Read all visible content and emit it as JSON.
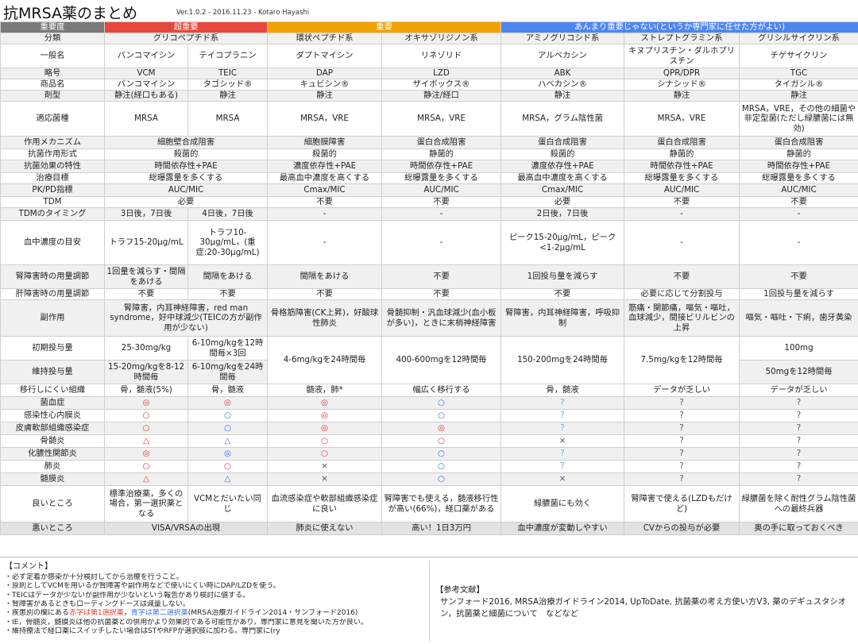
{
  "header": {
    "title": "抗MRSA薬のまとめ",
    "subtitle": "Ver.1.0.2 - 2016.11.23 - Kotaro Hayashi"
  },
  "importance": {
    "label": "重要度",
    "c1": "超重要",
    "c2": "重要",
    "c3": "あんまり重要じゃない(というか専門家に任せた方がよい)"
  },
  "rows": {
    "bunrui": {
      "label": "分類",
      "c1": "グリコペプチド系",
      "c2a": "環状ペプチド系",
      "c2b": "オキサゾリジノン系",
      "c3a": "アミノグリコシド系",
      "c3b": "ストレプトグラミン系",
      "c3c": "グリシルサイクリン系"
    },
    "ippanmei": {
      "label": "一般名",
      "d": [
        "バンコマイシン",
        "テイコプラニン",
        "ダプトマイシン",
        "リネゾリド",
        "アルベカシン",
        "キヌプリスチン・ダルホプリスチン",
        "チゲサイクリン"
      ]
    },
    "ryakugo": {
      "label": "略号",
      "d": [
        "VCM",
        "TEIC",
        "DAP",
        "LZD",
        "ABK",
        "QPR/DPR",
        "TGC"
      ]
    },
    "shohinmei": {
      "label": "商品名",
      "d": [
        "バンコマイシン",
        "タゴシッド®",
        "キュビシン®",
        "ザイボックス®",
        "ハベカシン®",
        "シナシッド®",
        "タイガシル®"
      ]
    },
    "zaikei": {
      "label": "剤型",
      "d": [
        "静注(経口もある)",
        "静注",
        "静注",
        "静注/経口",
        "静注",
        "静注",
        "静注"
      ]
    },
    "tekio": {
      "label": "適応菌種",
      "d": [
        "MRSA",
        "MRSA",
        "MRSA，VRE",
        "MRSA，VRE",
        "MRSA，グラム陰性菌",
        "MRSA，VRE",
        "MRSA，VRE，その他の細菌や非定型菌(ただし緑膿菌には無効)"
      ]
    },
    "sayo": {
      "label": "作用メカニズム",
      "c1": "細胞壁合成阻害",
      "d": [
        "細胞膜障害",
        "蛋白合成阻害",
        "蛋白合成阻害",
        "蛋白合成阻害",
        "蛋白合成阻害"
      ]
    },
    "keishiki": {
      "label": "抗菌作用形式",
      "c1": "殺菌的",
      "d": [
        "殺菌的",
        "静菌的",
        "殺菌的",
        "静菌的",
        "静菌的"
      ]
    },
    "tokusei": {
      "label": "抗菌効果の特性",
      "c1": "時間依存性+PAE",
      "d": [
        "濃度依存性+PAE",
        "時間依存性+PAE",
        "濃度依存性+PAE",
        "時間依存性+PAE",
        "時間依存性+PAE"
      ]
    },
    "mokuhyo": {
      "label": "治療目標",
      "c1": "総曝露量を多くする",
      "d": [
        "最高血中濃度を高くする",
        "総曝露量を多くする",
        "最高血中濃度を高くする",
        "総曝露量を多くする",
        "総曝露量を多くする"
      ]
    },
    "pkpd": {
      "label": "PK/PD指標",
      "c1": "AUC/MIC",
      "d": [
        "Cmax/MIC",
        "AUC/MIC",
        "Cmax/MIC",
        "AUC/MIC",
        "AUC/MIC"
      ]
    },
    "tdm": {
      "label": "TDM",
      "c1": "必要",
      "d": [
        "不要",
        "不要",
        "必要",
        "不要",
        "不要"
      ]
    },
    "timing": {
      "label": "TDMのタイミング",
      "d": [
        "3日後，7日後",
        "4日後，7日後",
        "-",
        "-",
        "2日後，7日後",
        "-",
        "-"
      ]
    },
    "noudo": {
      "label": "血中濃度の目安",
      "d": [
        "トラフ15-20μg/mL",
        "トラフ10-30μg/mL，(重症:20-30μg/mL)",
        "-",
        "-",
        "ピーク15-20μg/mL，ピーク<1-2μg/mL",
        "-",
        "-"
      ]
    },
    "jin": {
      "label": "腎障害時の用量調節",
      "d": [
        "1回量を減らす・間隔をあける",
        "間隔をあける",
        "間隔をあける",
        "不要",
        "1回投与量を減らす",
        "不要",
        "不要"
      ]
    },
    "kan": {
      "label": "肝障害時の用量調節",
      "d": [
        "不要",
        "不要",
        "不要",
        "不要",
        "不要",
        "必要に応じて分割投与",
        "1回投与量を減らす"
      ]
    },
    "fuku": {
      "label": "副作用",
      "c1": "腎障害，内耳神経障害，red man syndrome，好中球減少(TEICの方が副作用が少ない)",
      "d": [
        "骨格筋障害(CK上昇)，好酸球性肺炎",
        "骨髄抑制・汎血球減少(血小板が多い)，ときに末梢神経障害",
        "腎障害，内耳神経障害，呼吸抑制",
        "筋痛・関節痛，嘔気・嘔吐，血球減少，間接ビリルビンの上昇",
        "嘔気・嘔吐・下痢，歯牙黄染"
      ]
    },
    "shoki": {
      "label": "初期投与量",
      "d": [
        "25-30mg/kg",
        "6-10mg/kgを12時間毎×3回"
      ],
      "c7": "100mg"
    },
    "iji": {
      "label": "維持投与量",
      "d": [
        "15-20mg/kgを8-12時間毎",
        "6-10mg/kgを24時間毎"
      ],
      "c7": "50mgを12時間毎"
    },
    "dose": {
      "d": [
        "4-6mg/kgを24時間毎",
        "400-600mgを12時間毎",
        "150-200mgを24時間毎",
        "7.5mg/kgを12時間毎"
      ]
    },
    "ikou": {
      "label": "移行しにくい組織",
      "d": [
        "骨，髄液(5%)",
        "骨，髄液",
        "髄液，肺*",
        "幅広く移行する",
        "骨，髄液",
        "データが乏しい",
        "データが乏しい"
      ]
    },
    "kinketsu": {
      "label": "菌血症",
      "d": [
        "◎",
        "◎",
        "◎",
        "○",
        "?",
        "?",
        "?"
      ]
    },
    "naimaku": {
      "label": "感染性心内膜炎",
      "d": [
        "○",
        "○",
        "◎",
        "○",
        "?",
        "?",
        "?"
      ]
    },
    "hifu": {
      "label": "皮膚軟部組織感染症",
      "d": [
        "○",
        "○",
        "◎",
        "◎",
        "?",
        "?",
        "?"
      ]
    },
    "kotsuzui": {
      "label": "骨髄炎",
      "d": [
        "△",
        "△",
        "○",
        "○",
        "×",
        "?",
        "?"
      ]
    },
    "kanoukansetsu": {
      "label": "化膿性関節炎",
      "d": [
        "◎",
        "◎",
        "○",
        "○",
        "?",
        "?",
        "?"
      ]
    },
    "haien": {
      "label": "肺炎",
      "d": [
        "○",
        "○",
        "×",
        "○",
        "?",
        "?",
        "?"
      ]
    },
    "zuimaku": {
      "label": "髄膜炎",
      "d": [
        "△",
        "△",
        "×",
        "○",
        "×",
        "?",
        "?"
      ]
    },
    "yoi": {
      "label": "良いところ",
      "d": [
        "標準治療薬，多くの場合，第一選択薬となる",
        "VCMとだいたい同じ",
        "血流感染症や軟部組織感染症に良い",
        "腎障害でも使える，髄液移行性が高い(66%)，経口薬がある",
        "緑膿菌にも効く",
        "腎障害で使える(LZDもだけど)",
        "緑膿菌を除く耐性グラム陰性菌への最終兵器"
      ]
    },
    "warui": {
      "label": "悪いところ",
      "c1": "VISA/VRSAの出現",
      "d": [
        "肺炎に使えない",
        "高い！1日3万円",
        "血中濃度が変動しやすい",
        "CVからの投与が必要",
        "奥の手に取っておくべき"
      ]
    }
  },
  "comments": {
    "title": "【コメント】",
    "lines": [
      "・必ず定着か感染か十分検討してから治療を行うこと。",
      "・原則としてVCMを用いるが腎障害や副作用などで使いにくい時にDAP/LZDを使う。",
      "・TEICはデータが少ないが副作用が少ないという報告があり検討に値する。",
      "・腎障害があるときもローディングドーズは減量しない。",
      "・疾患別の欄にある",
      "赤字は第1選択薬",
      "，",
      "青字は第二選択薬",
      "(MRSA治療ガイドライン2014・サンフォード2016)",
      "・IE，骨髄炎，髄膜炎は他の抗菌薬との併用がより効果的である可能性があり，専門家に意見を聞いた方が良い。",
      "・維持療法で経口薬にスイッチしたい場合はSTやRFPが選択肢に加わる。専門家に(ry"
    ]
  },
  "refs": {
    "title": "【参考文献】",
    "text": "サンフォード2016, MRSA治療ガイドライン2014, UpToDate, 抗菌薬の考え方使い方V3, 薬のデギュスタシオン，抗菌薬と細菌について　などなど"
  }
}
